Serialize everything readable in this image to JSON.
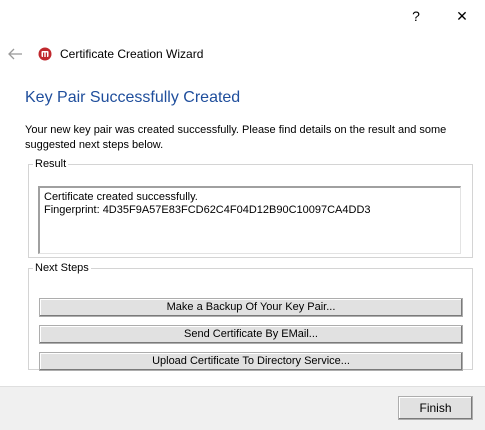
{
  "titlebar": {
    "help_label": "?",
    "close_label": "✕"
  },
  "header": {
    "wizard_title": "Certificate Creation Wizard",
    "back_icon": "back-arrow-icon",
    "app_icon": "certificate-app-icon"
  },
  "page": {
    "title": "Key Pair Successfully Created",
    "intro": "Your new key pair was created successfully. Please find details on the result and some suggested next steps below."
  },
  "result": {
    "legend": "Result",
    "line1": "Certificate created successfully.",
    "line2": "Fingerprint: 4D35F9A57E83FCD62C4F04D12B90C10097CA4DD3"
  },
  "next_steps": {
    "legend": "Next Steps",
    "backup_label": "Make a Backup Of Your Key Pair...",
    "send_label": "Send Certificate By EMail...",
    "upload_label": "Upload Certificate To Directory Service..."
  },
  "footer": {
    "finish_label": "Finish"
  },
  "colors": {
    "title_blue": "#1f4e9c",
    "icon_red": "#c0282d"
  }
}
